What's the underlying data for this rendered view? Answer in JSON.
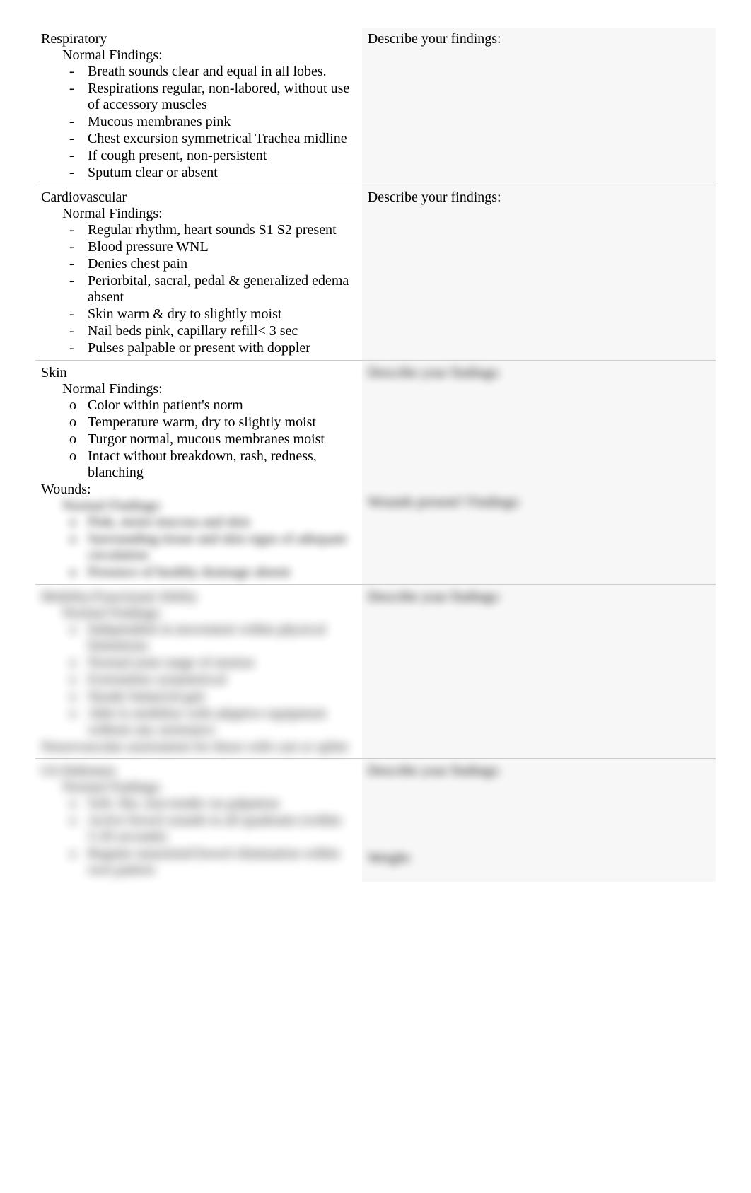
{
  "sections": {
    "respiratory": {
      "title": "Respiratory",
      "normal_label": "Normal Findings:",
      "items": [
        "Breath sounds clear and equal in all lobes.",
        "Respirations regular, non-labored, without use of accessory muscles",
        "Mucous membranes pink",
        "Chest excursion symmetrical Trachea midline",
        "If cough present, non-persistent",
        "Sputum clear or absent"
      ],
      "right_label": "Describe your findings:"
    },
    "cardiovascular": {
      "title": "Cardiovascular",
      "normal_label": "Normal Findings:",
      "items": [
        "Regular rhythm, heart sounds S1 S2 present",
        "Blood pressure WNL",
        "Denies chest pain",
        "Periorbital, sacral, pedal & generalized edema absent",
        "Skin warm & dry to slightly moist",
        "Nail beds pink, capillary refill< 3 sec",
        "Pulses palpable or present with doppler"
      ],
      "right_label": "Describe your findings:"
    },
    "skin": {
      "title": "Skin",
      "normal_label": "Normal Findings:",
      "items": [
        "Color within patient's norm",
        "Temperature warm,  dry  to slightly moist",
        "Turgor  normal,  mucous  membranes moist",
        "Intact without breakdown, rash, redness, blanching"
      ],
      "right_label": "Describe your findings:"
    },
    "wounds": {
      "title": "Wounds:",
      "normal_label": "Normal Findings:",
      "items": [
        "Pink, moist mucosa and skin",
        "Surrounding tissue and skin signs of adequate circulation",
        "Presence of healthy drainage absent"
      ],
      "right_label": "Wounds present? Findings:"
    },
    "mobility": {
      "title": "Mobility/Functional Ability",
      "normal_label": "Normal Findings:",
      "items": [
        "Independent in movement within physical limitations",
        "Normal joint range of motion",
        "Extremities symmetrical",
        "Steady balanced gait",
        "Able to mobilize with adaptive equipment without any assistance"
      ],
      "note": "Neurovascular assessment for those with cast or splint",
      "right_label": "Describe your findings:"
    },
    "gi": {
      "title": "GI/Abdomen",
      "normal_label": "Normal Findings:",
      "items": [
        "Soft, flat, non-tender on palpation",
        "Active bowel sounds in all quadrants (within 5-20 seconds)",
        "Regular unassisted bowel elimination within own pattern"
      ],
      "right_label": "Describe your findings:",
      "weight_label": "Weight:"
    }
  },
  "markers": {
    "square": "",
    "dash": "-",
    "circle": "o"
  }
}
